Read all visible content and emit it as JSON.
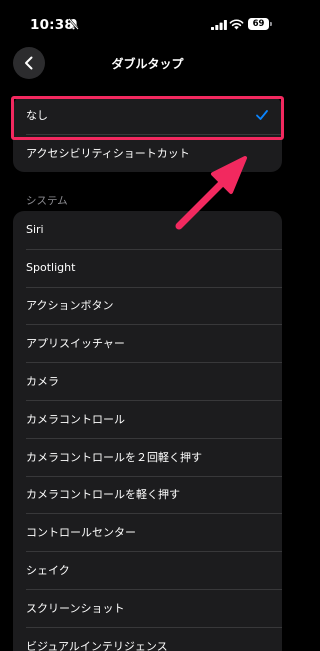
{
  "status": {
    "time": "10:38",
    "battery": "69"
  },
  "header": {
    "title": "ダブルタップ"
  },
  "options": [
    {
      "label": "なし",
      "selected": true
    },
    {
      "label": "アクセシビリティショートカット",
      "selected": false
    }
  ],
  "system": {
    "header": "システム",
    "items": [
      "Siri",
      "Spotlight",
      "アクションボタン",
      "アプリスイッチャー",
      "カメラ",
      "カメラコントロール",
      "カメラコントロールを２回軽く押す",
      "カメラコントロールを軽く押す",
      "コントロールセンター",
      "シェイク",
      "スクリーンショット",
      "ビジュアルインテリジェンス"
    ]
  },
  "colors": {
    "accent": "#0a84ff",
    "annotation": "#f2295f",
    "cell_bg": "#1c1c1e"
  }
}
